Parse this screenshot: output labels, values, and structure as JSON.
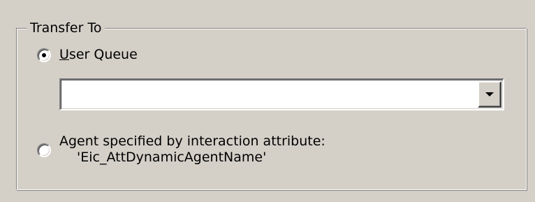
{
  "group": {
    "title": "Transfer To"
  },
  "options": {
    "user_queue": {
      "label_mnemonic": "U",
      "label_rest": "ser Queue",
      "checked": true
    },
    "agent_attr": {
      "label_line1": "Agent specified by interaction attribute:",
      "label_line2": "'Eic_AttDynamicAgentName'",
      "checked": false
    }
  },
  "user_queue_combo": {
    "value": "",
    "dropdown_icon": "chevron-down-icon"
  }
}
